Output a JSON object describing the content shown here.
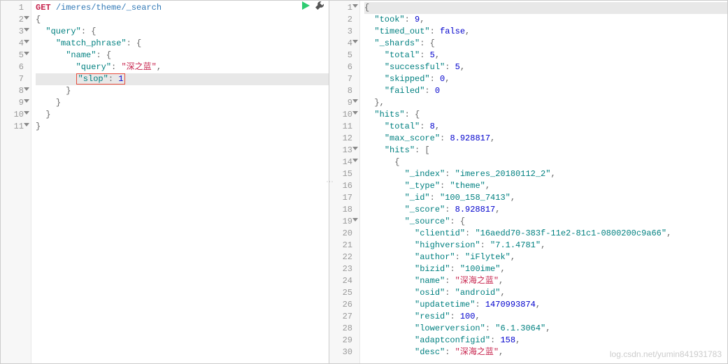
{
  "request": {
    "method": "GET",
    "url": "/imeres/theme/_search",
    "body_lines": [
      {
        "n": 1,
        "kind": "req",
        "fold": false
      },
      {
        "n": 2,
        "fold": true,
        "tokens": [
          [
            "punc",
            "{"
          ]
        ]
      },
      {
        "n": 3,
        "fold": true,
        "indent": 1,
        "tokens": [
          [
            "key",
            "\"query\""
          ],
          [
            "punc",
            ": {"
          ]
        ]
      },
      {
        "n": 4,
        "fold": true,
        "indent": 2,
        "tokens": [
          [
            "key",
            "\"match_phrase\""
          ],
          [
            "punc",
            ": {"
          ]
        ]
      },
      {
        "n": 5,
        "fold": true,
        "indent": 3,
        "tokens": [
          [
            "key",
            "\"name\""
          ],
          [
            "punc",
            ": {"
          ]
        ]
      },
      {
        "n": 6,
        "indent": 4,
        "tokens": [
          [
            "key",
            "\"query\""
          ],
          [
            "punc",
            ": "
          ],
          [
            "strcn",
            "\"深之蓝\""
          ],
          [
            "punc",
            ","
          ]
        ]
      },
      {
        "n": 7,
        "indent": 4,
        "hl": true,
        "redbox": true,
        "tokens": [
          [
            "key",
            "\"slop\""
          ],
          [
            "punc",
            ": "
          ],
          [
            "num",
            "1"
          ]
        ]
      },
      {
        "n": 8,
        "fold": true,
        "indent": 3,
        "tokens": [
          [
            "punc",
            "}"
          ]
        ]
      },
      {
        "n": 9,
        "fold": true,
        "indent": 2,
        "tokens": [
          [
            "punc",
            "}"
          ]
        ]
      },
      {
        "n": 10,
        "fold": true,
        "indent": 1,
        "tokens": [
          [
            "punc",
            "}"
          ]
        ]
      },
      {
        "n": 11,
        "fold": true,
        "tokens": [
          [
            "punc",
            "}"
          ]
        ]
      }
    ]
  },
  "response": {
    "lines": [
      {
        "n": 1,
        "fold": true,
        "hl": true,
        "tokens": [
          [
            "punc",
            "{"
          ]
        ]
      },
      {
        "n": 2,
        "indent": 1,
        "tokens": [
          [
            "key",
            "\"took\""
          ],
          [
            "punc",
            ": "
          ],
          [
            "num",
            "9"
          ],
          [
            "punc",
            ","
          ]
        ]
      },
      {
        "n": 3,
        "indent": 1,
        "tokens": [
          [
            "key",
            "\"timed_out\""
          ],
          [
            "punc",
            ": "
          ],
          [
            "bool",
            "false"
          ],
          [
            "punc",
            ","
          ]
        ]
      },
      {
        "n": 4,
        "fold": true,
        "indent": 1,
        "tokens": [
          [
            "key",
            "\"_shards\""
          ],
          [
            "punc",
            ": {"
          ]
        ]
      },
      {
        "n": 5,
        "indent": 2,
        "tokens": [
          [
            "key",
            "\"total\""
          ],
          [
            "punc",
            ": "
          ],
          [
            "num",
            "5"
          ],
          [
            "punc",
            ","
          ]
        ]
      },
      {
        "n": 6,
        "indent": 2,
        "tokens": [
          [
            "key",
            "\"successful\""
          ],
          [
            "punc",
            ": "
          ],
          [
            "num",
            "5"
          ],
          [
            "punc",
            ","
          ]
        ]
      },
      {
        "n": 7,
        "indent": 2,
        "tokens": [
          [
            "key",
            "\"skipped\""
          ],
          [
            "punc",
            ": "
          ],
          [
            "num",
            "0"
          ],
          [
            "punc",
            ","
          ]
        ]
      },
      {
        "n": 8,
        "indent": 2,
        "tokens": [
          [
            "key",
            "\"failed\""
          ],
          [
            "punc",
            ": "
          ],
          [
            "num",
            "0"
          ]
        ]
      },
      {
        "n": 9,
        "fold": true,
        "indent": 1,
        "tokens": [
          [
            "punc",
            "},"
          ]
        ]
      },
      {
        "n": 10,
        "fold": true,
        "indent": 1,
        "tokens": [
          [
            "key",
            "\"hits\""
          ],
          [
            "punc",
            ": {"
          ]
        ]
      },
      {
        "n": 11,
        "indent": 2,
        "tokens": [
          [
            "key",
            "\"total\""
          ],
          [
            "punc",
            ": "
          ],
          [
            "num",
            "8"
          ],
          [
            "punc",
            ","
          ]
        ]
      },
      {
        "n": 12,
        "indent": 2,
        "tokens": [
          [
            "key",
            "\"max_score\""
          ],
          [
            "punc",
            ": "
          ],
          [
            "num",
            "8.928817"
          ],
          [
            "punc",
            ","
          ]
        ]
      },
      {
        "n": 13,
        "fold": true,
        "indent": 2,
        "tokens": [
          [
            "key",
            "\"hits\""
          ],
          [
            "punc",
            ": ["
          ]
        ]
      },
      {
        "n": 14,
        "fold": true,
        "indent": 3,
        "tokens": [
          [
            "punc",
            "{"
          ]
        ]
      },
      {
        "n": 15,
        "indent": 4,
        "tokens": [
          [
            "key",
            "\"_index\""
          ],
          [
            "punc",
            ": "
          ],
          [
            "str",
            "\"imeres_20180112_2\""
          ],
          [
            "punc",
            ","
          ]
        ]
      },
      {
        "n": 16,
        "indent": 4,
        "tokens": [
          [
            "key",
            "\"_type\""
          ],
          [
            "punc",
            ": "
          ],
          [
            "str",
            "\"theme\""
          ],
          [
            "punc",
            ","
          ]
        ]
      },
      {
        "n": 17,
        "indent": 4,
        "tokens": [
          [
            "key",
            "\"_id\""
          ],
          [
            "punc",
            ": "
          ],
          [
            "str",
            "\"100_158_7413\""
          ],
          [
            "punc",
            ","
          ]
        ]
      },
      {
        "n": 18,
        "indent": 4,
        "tokens": [
          [
            "key",
            "\"_score\""
          ],
          [
            "punc",
            ": "
          ],
          [
            "num",
            "8.928817"
          ],
          [
            "punc",
            ","
          ]
        ]
      },
      {
        "n": 19,
        "fold": true,
        "indent": 4,
        "tokens": [
          [
            "key",
            "\"_source\""
          ],
          [
            "punc",
            ": {"
          ]
        ]
      },
      {
        "n": 20,
        "indent": 5,
        "tokens": [
          [
            "key",
            "\"clientid\""
          ],
          [
            "punc",
            ": "
          ],
          [
            "str",
            "\"16aedd70-383f-11e2-81c1-0800200c9a66\""
          ],
          [
            "punc",
            ","
          ]
        ]
      },
      {
        "n": 21,
        "indent": 5,
        "tokens": [
          [
            "key",
            "\"highversion\""
          ],
          [
            "punc",
            ": "
          ],
          [
            "str",
            "\"7.1.4781\""
          ],
          [
            "punc",
            ","
          ]
        ]
      },
      {
        "n": 22,
        "indent": 5,
        "tokens": [
          [
            "key",
            "\"author\""
          ],
          [
            "punc",
            ": "
          ],
          [
            "str",
            "\"iFlytek\""
          ],
          [
            "punc",
            ","
          ]
        ]
      },
      {
        "n": 23,
        "indent": 5,
        "tokens": [
          [
            "key",
            "\"bizid\""
          ],
          [
            "punc",
            ": "
          ],
          [
            "str",
            "\"100ime\""
          ],
          [
            "punc",
            ","
          ]
        ]
      },
      {
        "n": 24,
        "indent": 5,
        "tokens": [
          [
            "key",
            "\"name\""
          ],
          [
            "punc",
            ": "
          ],
          [
            "strcn",
            "\"深海之蓝\""
          ],
          [
            "punc",
            ","
          ]
        ]
      },
      {
        "n": 25,
        "indent": 5,
        "tokens": [
          [
            "key",
            "\"osid\""
          ],
          [
            "punc",
            ": "
          ],
          [
            "str",
            "\"android\""
          ],
          [
            "punc",
            ","
          ]
        ]
      },
      {
        "n": 26,
        "indent": 5,
        "tokens": [
          [
            "key",
            "\"updatetime\""
          ],
          [
            "punc",
            ": "
          ],
          [
            "num",
            "1470993874"
          ],
          [
            "punc",
            ","
          ]
        ]
      },
      {
        "n": 27,
        "indent": 5,
        "tokens": [
          [
            "key",
            "\"resid\""
          ],
          [
            "punc",
            ": "
          ],
          [
            "num",
            "100"
          ],
          [
            "punc",
            ","
          ]
        ]
      },
      {
        "n": 28,
        "indent": 5,
        "tokens": [
          [
            "key",
            "\"lowerversion\""
          ],
          [
            "punc",
            ": "
          ],
          [
            "str",
            "\"6.1.3064\""
          ],
          [
            "punc",
            ","
          ]
        ]
      },
      {
        "n": 29,
        "indent": 5,
        "tokens": [
          [
            "key",
            "\"adaptconfigid\""
          ],
          [
            "punc",
            ": "
          ],
          [
            "num",
            "158"
          ],
          [
            "punc",
            ","
          ]
        ]
      },
      {
        "n": 30,
        "indent": 5,
        "tokens": [
          [
            "key",
            "\"desc\""
          ],
          [
            "punc",
            ": "
          ],
          [
            "strcn",
            "\"深海之蓝\""
          ],
          [
            "punc",
            ","
          ]
        ]
      }
    ]
  },
  "toolbar": {
    "play_title": "Run",
    "wrench_title": "Settings"
  },
  "watermark": "log.csdn.net/yumin841931783"
}
